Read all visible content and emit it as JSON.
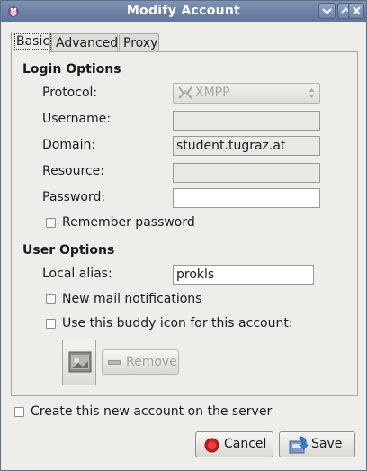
{
  "window": {
    "title": "Modify Account",
    "app_icon": "pidgin-icon"
  },
  "titlebar_buttons": [
    {
      "name": "minimize-button",
      "icon": "minimize-icon"
    },
    {
      "name": "maximize-button",
      "icon": "maximize-icon"
    },
    {
      "name": "close-button",
      "icon": "close-icon"
    }
  ],
  "tabs": [
    {
      "label": "Basic",
      "selected": true
    },
    {
      "label": "Advanced",
      "selected": false
    },
    {
      "label": "Proxy",
      "selected": false
    }
  ],
  "login_options": {
    "heading": "Login Options",
    "protocol_label": "Protocol:",
    "protocol_value": "XMPP",
    "protocol_icon": "xmpp-icon",
    "username_label": "Username:",
    "username_value": "",
    "domain_label": "Domain:",
    "domain_value": "student.tugraz.at",
    "resource_label": "Resource:",
    "resource_value": "",
    "password_label": "Password:",
    "password_value": "",
    "remember_password_label": "Remember password",
    "remember_password_checked": false
  },
  "user_options": {
    "heading": "User Options",
    "local_alias_label": "Local alias:",
    "local_alias_value": "prokls",
    "new_mail_label": "New mail notifications",
    "new_mail_checked": false,
    "buddy_icon_label": "Use this buddy icon for this account:",
    "buddy_icon_checked": false,
    "remove_label": "Remove"
  },
  "create_account": {
    "label": "Create this new account on the server",
    "checked": false
  },
  "buttons": {
    "cancel_label": "Cancel",
    "save_label": "Save"
  },
  "colors": {
    "titlebar": "#6a80a4",
    "window_bg": "#edede9",
    "cancel_icon": "#d01818"
  }
}
